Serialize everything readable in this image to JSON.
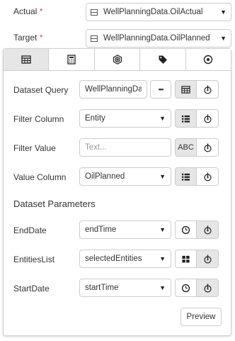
{
  "top": {
    "actual_label": "Actual",
    "target_label": "Target",
    "required_mark": "*",
    "actual_value": "WellPlanningData.OilActual",
    "target_value": "WellPlanningData.OilPlanned",
    "table_icon": "table-icon",
    "caret_icon": "caret-down-icon"
  },
  "tabs": [
    {
      "icon": "table-icon",
      "active": true
    },
    {
      "icon": "calculator-icon",
      "active": false
    },
    {
      "icon": "hexagon-network-icon",
      "active": false
    },
    {
      "icon": "tag-icon",
      "active": false
    },
    {
      "icon": "target-circle-icon",
      "active": false
    }
  ],
  "form": {
    "dataset_query_label": "Dataset Query",
    "dataset_query_value": "WellPlanningDa",
    "more_button": "•••",
    "filter_column_label": "Filter Column",
    "filter_column_value": "Entity",
    "filter_value_label": "Filter Value",
    "filter_value_placeholder": "Text...",
    "abc_button": "ABC",
    "value_column_label": "Value Column",
    "value_column_value": "OilPlanned"
  },
  "params": {
    "section_title": "Dataset Parameters",
    "items": [
      {
        "label": "EndDate",
        "value": "endTime",
        "icon": "clock-icon"
      },
      {
        "label": "EntitiesList",
        "value": "selectedEntities",
        "icon": "grid-icon"
      },
      {
        "label": "StartDate",
        "value": "startTime",
        "icon": "clock-icon"
      }
    ]
  },
  "footer": {
    "preview_button": "Preview"
  },
  "colors": {
    "required": "#d9534f",
    "active_bg": "#e6e6e6",
    "border": "#cccccc"
  }
}
